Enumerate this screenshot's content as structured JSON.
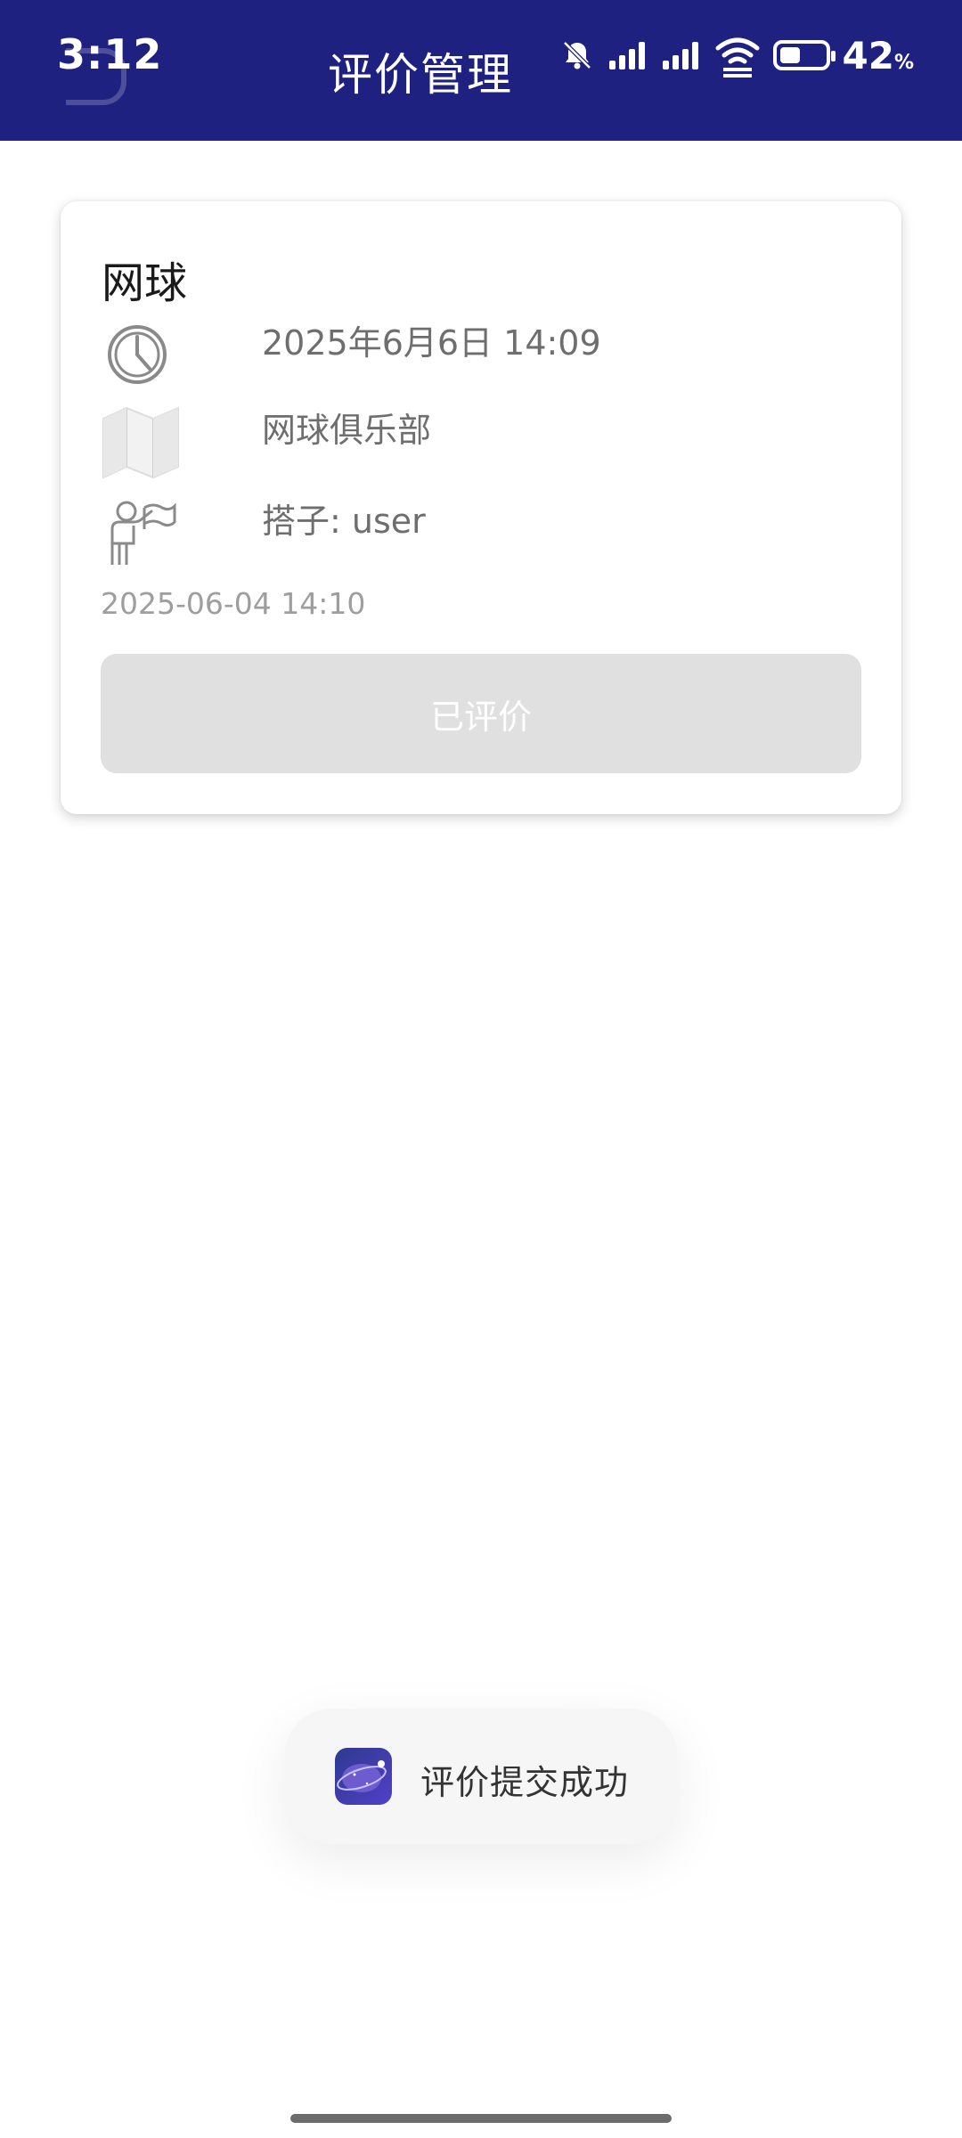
{
  "status_bar": {
    "time": "3:12",
    "battery_level": "42",
    "battery_unit": "%",
    "icons": [
      "bell-off-icon",
      "signal-icon",
      "signal-icon",
      "wifi-icon",
      "battery-icon"
    ]
  },
  "header": {
    "title": "评价管理"
  },
  "card": {
    "title": "网球",
    "time_text": "2025年6月6日 14:09",
    "place_text": "网球俱乐部",
    "partner_text": "搭子: user",
    "created_at": "2025-06-04 14:10",
    "button_label": "已评价"
  },
  "toast": {
    "message": "评价提交成功",
    "icon": "app-icon"
  },
  "colors": {
    "header_bg": "#1e2180",
    "button_disabled_bg": "#e0e0e0",
    "secondary_text": "#6e6e6e",
    "tertiary_text": "#9e9e9e"
  }
}
